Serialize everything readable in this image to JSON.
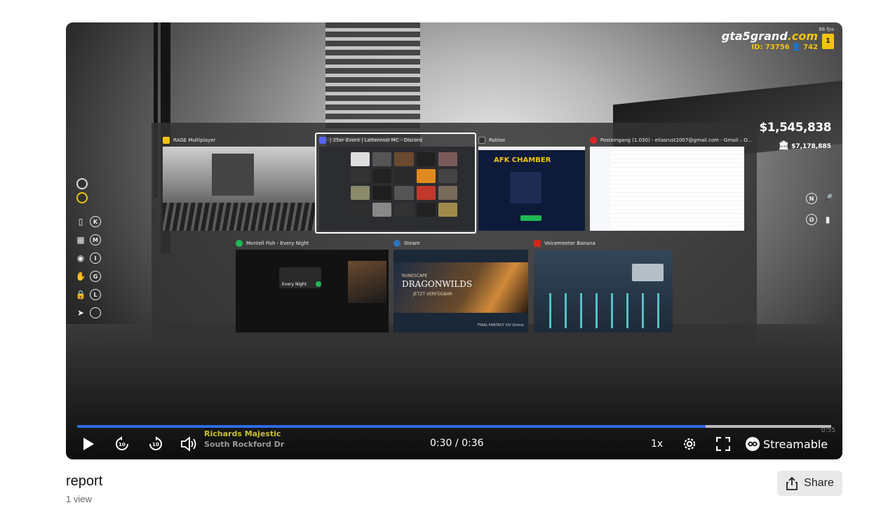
{
  "video": {
    "hud": {
      "logo_main": "gta5grand",
      "logo_ext": ".com",
      "fps": "66 fps",
      "badge": "1",
      "id_line": "ID: 73756",
      "online_count": "742",
      "cash": "$1,545,838",
      "bank": "$7,178,885",
      "right_keys": [
        "N",
        "O"
      ],
      "left_keys": [
        "K",
        "M",
        "I",
        "G",
        "L",
        ""
      ],
      "left_icon_names": [
        "phone-icon",
        "grid-icon",
        "mouse-icon",
        "hand-icon",
        "lock-icon",
        "cursor-icon"
      ]
    },
    "switcher": {
      "windows": [
        {
          "title": "RAGE Multiplayer",
          "icon": "rage-icon",
          "icon_color": "#f1c40f"
        },
        {
          "title": "| 25er Event | Lattenrost MC - Discord",
          "icon": "discord-icon",
          "icon_color": "#5865f2"
        },
        {
          "title": "Roblox",
          "icon": "roblox-icon",
          "icon_color": "#333333"
        },
        {
          "title": "Posteingang (1.030) - eliasrust2007@gmail.com - Gmail – O...",
          "icon": "opera-icon",
          "icon_color": "#e0242b"
        },
        {
          "title": "Montell Fish - Every Night",
          "icon": "spotify-icon",
          "icon_color": "#1db954"
        },
        {
          "title": "Steam",
          "icon": "steam-icon",
          "icon_color": "#2a75bb"
        },
        {
          "title": "Voicemeeter Banana",
          "icon": "voicemeeter-icon",
          "icon_color": "#d3261b"
        }
      ],
      "roblox_heading": "AFK CHAMBER",
      "steam_banner_line1": "RUNESCAPE",
      "steam_banner_line2": "DRAGONWILDS",
      "steam_banner_line3": "JETZT VERFÜGBAR",
      "steam_footer": "FINAL FANTASY XIV Online",
      "spotify_track": "Every Night"
    },
    "location": {
      "street": "Richards Majestic",
      "area": "South Rockford Dr"
    },
    "controls": {
      "current_time": "0:30",
      "total_time": "0:36",
      "progress": 0.8333,
      "speed": "1x",
      "brand": "Streamable",
      "rewind_seconds": "10",
      "forward_seconds": "10",
      "overlay_clock": "0:55"
    }
  },
  "page": {
    "title": "report",
    "views": "1 view",
    "share_label": "Share"
  }
}
